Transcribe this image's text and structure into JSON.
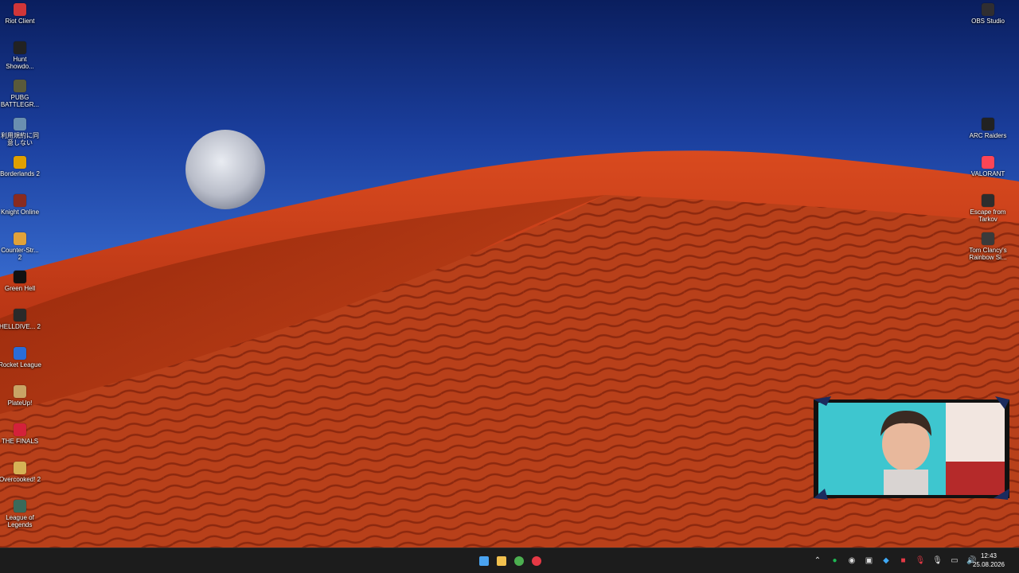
{
  "desktop_icons_left": [
    {
      "label": "Riot Client",
      "icon": "riot-client-icon",
      "color": "#d13639"
    },
    {
      "label": "Hunt Showdo...",
      "icon": "hunt-showdown-icon",
      "color": "#222222"
    },
    {
      "label": "PUBG BATTLEGR...",
      "icon": "pubg-icon",
      "color": "#5a5a3a"
    },
    {
      "label": "利用規約に同意しない",
      "icon": "game-shortcut-icon",
      "color": "#6a8fb0"
    },
    {
      "label": "Borderlands 2",
      "icon": "borderlands-icon",
      "color": "#e0a000"
    },
    {
      "label": "Knight Online",
      "icon": "knight-online-icon",
      "color": "#8a2b1f"
    },
    {
      "label": "Counter-Str... 2",
      "icon": "counter-strike-icon",
      "color": "#e1a23a"
    },
    {
      "label": "Green Hell",
      "icon": "green-hell-icon",
      "color": "#111111"
    },
    {
      "label": "HELLDIVE... 2",
      "icon": "helldivers-icon",
      "color": "#2a2a2a"
    },
    {
      "label": "Rocket League",
      "icon": "rocket-league-icon",
      "color": "#2a6dd9"
    },
    {
      "label": "PlateUp!",
      "icon": "plateup-icon",
      "color": "#c9a465"
    },
    {
      "label": "THE FINALS",
      "icon": "the-finals-icon",
      "color": "#d4213a"
    },
    {
      "label": "Overcooked! 2",
      "icon": "overcooked-icon",
      "color": "#d6b255"
    },
    {
      "label": "League of Legends",
      "icon": "league-of-legends-icon",
      "color": "#3a6a5a"
    }
  ],
  "desktop_icons_right": [
    {
      "label": "OBS Studio",
      "icon": "obs-studio-icon",
      "color": "#302e31"
    },
    {
      "label": "ARC Raiders",
      "icon": "arc-raiders-icon",
      "color": "#222222"
    },
    {
      "label": "VALORANT",
      "icon": "valorant-icon",
      "color": "#fd4556"
    },
    {
      "label": "Escape from Tarkov",
      "icon": "tarkov-icon",
      "color": "#2d2d2d"
    },
    {
      "label": "Tom Clancy's Rainbow Si...",
      "icon": "rainbow-six-icon",
      "color": "#3a3a3a"
    }
  ],
  "taskbar": {
    "apps": [
      {
        "icon": "windows-start-icon"
      },
      {
        "icon": "file-explorer-icon"
      },
      {
        "icon": "chrome-icon"
      },
      {
        "icon": "riot-client-taskbar-icon"
      }
    ],
    "tray": [
      {
        "icon": "chevron-up-icon"
      },
      {
        "icon": "spotify-icon"
      },
      {
        "icon": "obs-tray-icon"
      },
      {
        "icon": "app-tray-icon"
      },
      {
        "icon": "shield-tray-icon"
      },
      {
        "icon": "riot-tray-icon"
      },
      {
        "icon": "mic-muted-icon"
      },
      {
        "icon": "mic-icon"
      },
      {
        "icon": "network-icon"
      },
      {
        "icon": "volume-icon"
      }
    ],
    "time": "12:43",
    "date": "25.08.2026"
  }
}
